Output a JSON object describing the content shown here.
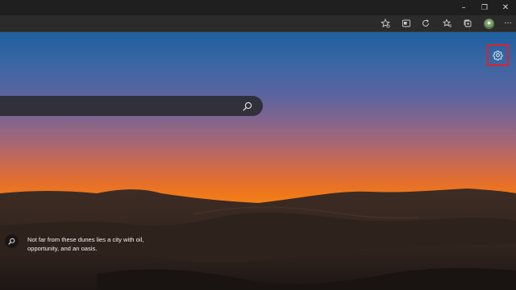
{
  "window": {
    "controls": [
      {
        "name": "minimize",
        "glyph": "–"
      },
      {
        "name": "restore",
        "glyph": "❐"
      },
      {
        "name": "close",
        "glyph": "✕"
      }
    ]
  },
  "toolbar": {
    "icons": [
      "favorite-star-icon",
      "reading-view-icon",
      "refresh-shield-icon",
      "favorites-icon",
      "collections-icon",
      "profile-avatar",
      "more-icon"
    ],
    "more_glyph": "···"
  },
  "background": {
    "colors": {
      "sky_top": "#1f5fa0",
      "sky_mid": "#a26676",
      "horizon": "#f17a18",
      "dunes": "#2c201c"
    }
  },
  "settings": {
    "icon": "gear-icon",
    "highlight_color": "#e0202d"
  },
  "search": {
    "placeholder": "",
    "icon": "search-icon"
  },
  "caption": {
    "icon": "search-icon",
    "text": "Not far from these dunes lies a city with oil, opportunity, and an oasis."
  }
}
